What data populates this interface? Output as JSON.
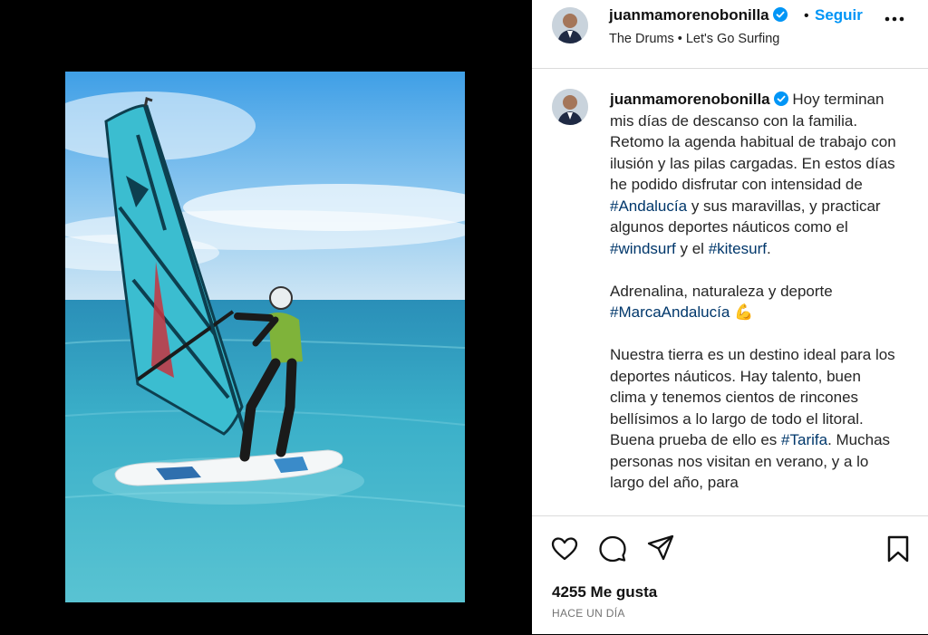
{
  "post": {
    "username": "juanmamorenobonilla",
    "separator": "•",
    "follow_label": "Seguir",
    "subtitle": "The Drums • Let's Go Surfing"
  },
  "caption": {
    "username": "juanmamorenobonilla",
    "p1": "Hoy terminan mis días de descanso con la familia. Retomo la agenda habitual de trabajo con ilusión y las pilas cargadas. En estos días he podido disfrutar con intensidad de",
    "p1_tag1": "#Andalucía",
    "p1_mid": "y sus maravillas, y practicar algunos deportes náuticos como el",
    "p1_tag2": "#windsurf",
    "p1_and": "y el",
    "p1_tag3": "#kitesurf",
    "p1_end": ".",
    "p2": "Adrenalina, naturaleza y deporte",
    "p2_tag": "#MarcaAndalucía",
    "p2_emoji": "💪",
    "p3": "Nuestra tierra es un destino ideal para los deportes náuticos. Hay talento, buen clima y tenemos cientos de rincones bellísimos a lo largo de todo el litoral. Buena prueba de ello es",
    "p3_tag": "#Tarifa",
    "p3_end": ". Muchas personas nos visitan en verano, y a lo largo del año, para"
  },
  "footer": {
    "likes": "4255 Me gusta",
    "time_ago": "HACE UN DÍA"
  },
  "icons": {
    "verified": "verified-badge-icon",
    "more": "more-options-icon",
    "like": "heart-icon",
    "comment": "comment-icon",
    "share": "send-icon",
    "save": "bookmark-icon"
  },
  "colors": {
    "accent": "#0095f6",
    "hashtag": "#00376b",
    "sail": "#2fb3c6"
  }
}
